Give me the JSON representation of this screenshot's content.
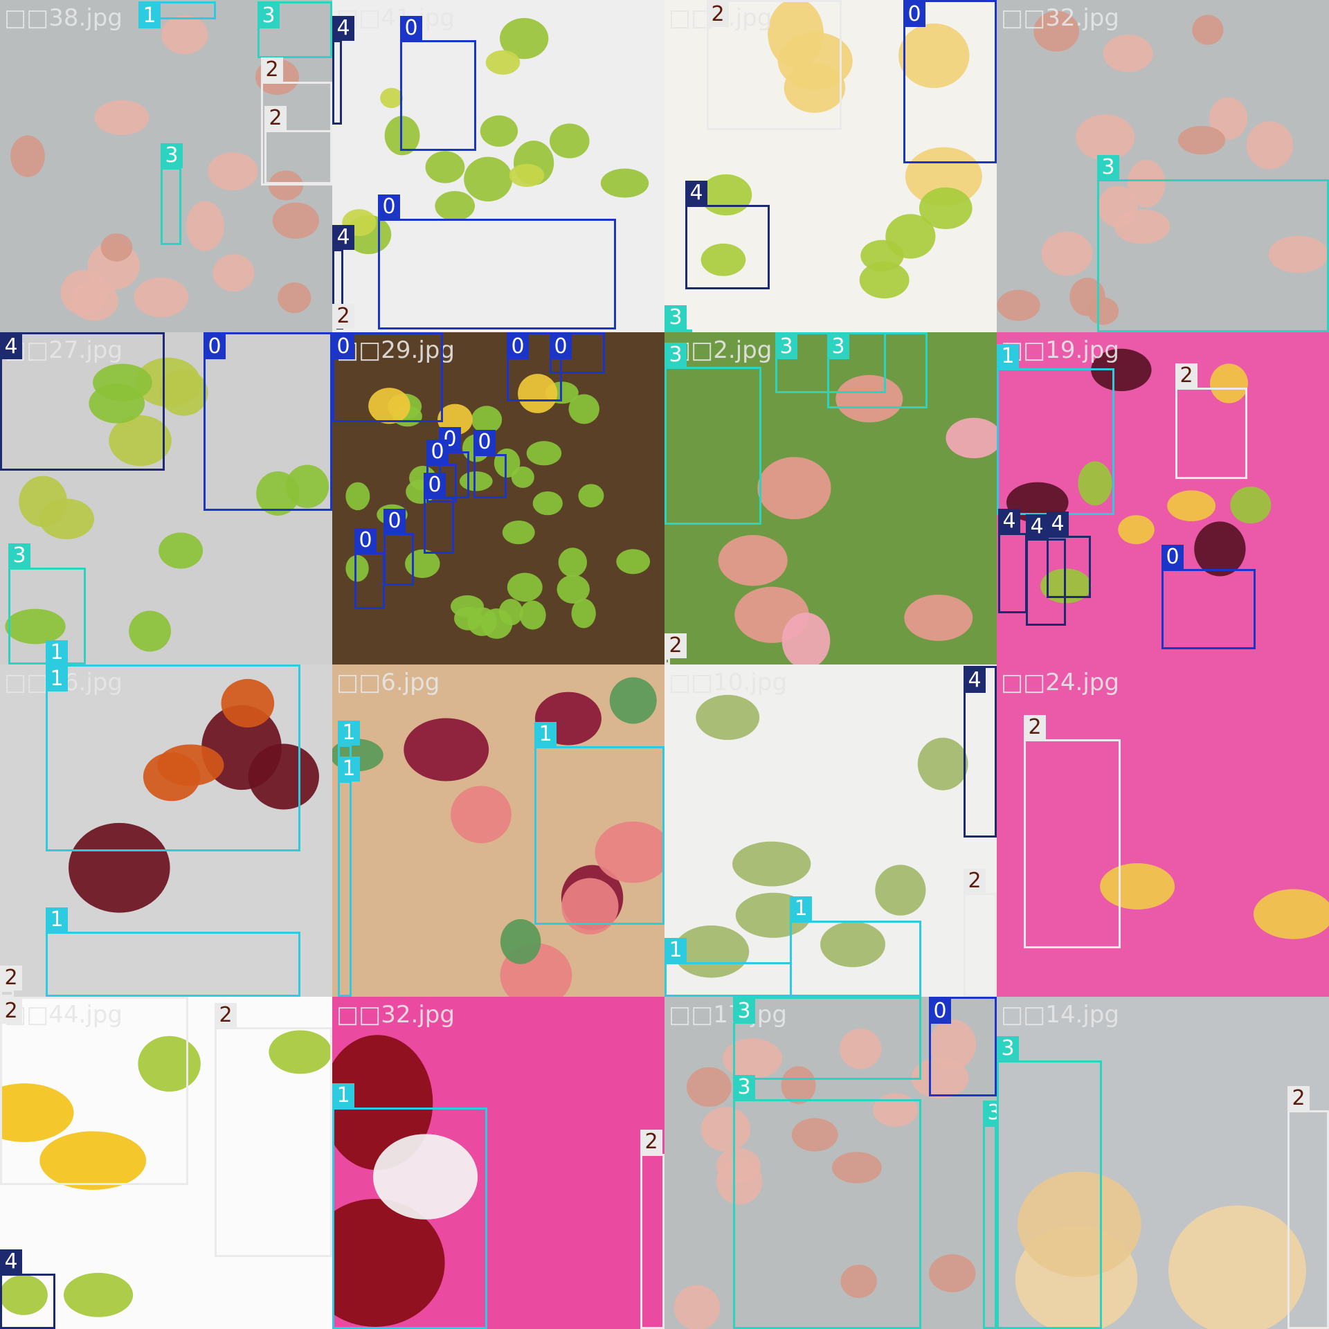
{
  "class_colors": {
    "0": "#1a35c8",
    "1": "#2ccbe0",
    "2": "#eaeaea",
    "3": "#2bd3c0",
    "4": "#1d2a70"
  },
  "tiles": [
    {
      "filename": "□□38.jpg",
      "scene": "peaches-tray",
      "labels": [
        "1",
        "3",
        "2",
        "2",
        "3",
        "4"
      ]
    },
    {
      "filename": "□□41.jpg",
      "scene": "green-apple-tape",
      "labels": [
        "4",
        "0",
        "0",
        "4",
        "2"
      ]
    },
    {
      "filename": "□□1.jpg",
      "scene": "bananas-starfruit",
      "labels": [
        "2",
        "0",
        "4",
        "3"
      ]
    },
    {
      "filename": "□□32.jpg",
      "scene": "peaches-tray",
      "labels": [
        "3"
      ]
    },
    {
      "filename": "□□27.jpg",
      "scene": "starfruit-apples",
      "labels": [
        "4",
        "0",
        "3",
        "1"
      ]
    },
    {
      "filename": "□□29.jpg",
      "scene": "bananas-apples",
      "labels": [
        "0",
        "0",
        "0",
        "0",
        "0",
        "0",
        "0",
        "0",
        "0"
      ]
    },
    {
      "filename": "□□2.jpg",
      "scene": "peaches-grass",
      "labels": [
        "3",
        "3",
        "3",
        "2"
      ]
    },
    {
      "filename": "□□19.jpg",
      "scene": "plums-banana-pink",
      "labels": [
        "1",
        "2",
        "4",
        "4",
        "4",
        "0"
      ]
    },
    {
      "filename": "□□16.jpg",
      "scene": "plums",
      "labels": [
        "1",
        "1",
        "2"
      ]
    },
    {
      "filename": "□□6.jpg",
      "scene": "plums-wood",
      "labels": [
        "1",
        "1",
        "1"
      ]
    },
    {
      "filename": "□□10.jpg",
      "scene": "green-bananas",
      "labels": [
        "4",
        "2",
        "1",
        "1"
      ]
    },
    {
      "filename": "□□24.jpg",
      "scene": "banana-pink",
      "labels": [
        "2"
      ]
    },
    {
      "filename": "□□44.jpg",
      "scene": "single-banana",
      "labels": [
        "2",
        "2",
        "4"
      ]
    },
    {
      "filename": "□□32.jpg",
      "scene": "plum-pink",
      "labels": [
        "1",
        "2"
      ]
    },
    {
      "filename": "□□17.jpg",
      "scene": "peaches-tray",
      "labels": [
        "3",
        "3",
        "0",
        "3"
      ]
    },
    {
      "filename": "□□14.jpg",
      "scene": "peach-tray",
      "labels": [
        "3",
        "2"
      ]
    }
  ]
}
